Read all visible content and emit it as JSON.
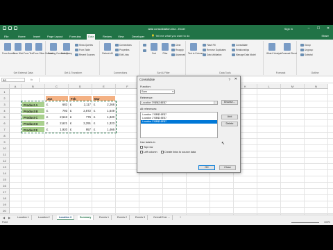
{
  "app": {
    "title": "data consolidation.xlsx - Excel",
    "user": "Sign in",
    "window_controls": [
      "–",
      "☐",
      "✕"
    ]
  },
  "tabs": [
    "File",
    "Home",
    "Insert",
    "Page Layout",
    "Formulas",
    "Data",
    "Review",
    "View",
    "Developer"
  ],
  "active_tab": "Data",
  "tell_me": "Tell me what you want to do",
  "share": "Share",
  "ribbon": {
    "groups": [
      {
        "label": "Get External Data"
      },
      {
        "label": "Get & Transform"
      },
      {
        "label": "Connections"
      },
      {
        "label": "Sort & Filter"
      },
      {
        "label": "Data Tools"
      },
      {
        "label": "Forecast"
      },
      {
        "label": "Outline"
      }
    ],
    "buttons": {
      "from_access": "From Access",
      "from_web": "From Web",
      "from_text": "From Text",
      "from_other": "From Other Sources",
      "existing": "Existing Connections",
      "new_query": "New Query",
      "show_queries": "Show Queries",
      "from_table": "From Table",
      "recent_sources": "Recent Sources",
      "refresh_all": "Refresh All",
      "connections": "Connections",
      "properties": "Properties",
      "edit_links": "Edit Links",
      "sort": "Sort",
      "filter": "Filter",
      "clear": "Clear",
      "reapply": "Reapply",
      "advanced": "Advanced",
      "text_to_columns": "Text to Columns",
      "flash_fill": "Flash Fill",
      "remove_duplicates": "Remove Duplicates",
      "data_validation": "Data Validation",
      "consolidate": "Consolidate",
      "relationships": "Relationships",
      "manage_data_model": "Manage Data Model",
      "what_if": "What-If Analysis",
      "forecast_sheet": "Forecast Sheet",
      "group": "Group",
      "ungroup": "Ungroup",
      "subtotal": "Subtotal"
    }
  },
  "formula_bar": {
    "name_box": "B3",
    "fx": "fx",
    "value": ""
  },
  "grid": {
    "columns": [
      "A",
      "B",
      "C",
      "D",
      "E",
      "F",
      "G",
      "H",
      "I",
      "J",
      "K",
      "L",
      "M",
      "N"
    ],
    "rows": [
      "1",
      "2",
      "3",
      "4",
      "5",
      "6",
      "7",
      "8",
      "9",
      "10",
      "11",
      "12",
      "13",
      "14",
      "15",
      "16",
      "17",
      "18",
      "19",
      "20"
    ],
    "header_row": [
      "Jan",
      "Feb",
      "Mar"
    ],
    "products": [
      {
        "name": "Product A",
        "jan": "683",
        "feb": "2,117",
        "mar": "2,268"
      },
      {
        "name": "Product B",
        "jan": "793",
        "feb": "2,872",
        "mar": "1,649"
      },
      {
        "name": "Product C",
        "jan": "2,543",
        "feb": "776",
        "mar": "1,320"
      },
      {
        "name": "Product D",
        "jan": "2,621",
        "feb": "2,291",
        "mar": "1,323"
      },
      {
        "name": "Product E",
        "jan": "1,920",
        "feb": "957",
        "mar": "1,466"
      }
    ],
    "currency": "£"
  },
  "sheets": {
    "tabs": [
      "Location 1",
      "Location 2",
      "Location 3",
      "Summary",
      "Events 1",
      "Events 2",
      "Events 3",
      "Overall Ever ..."
    ],
    "current": "Location 3",
    "active": "Summary",
    "add": "+"
  },
  "status": {
    "ready": "Point",
    "zoom": "100%"
  },
  "dialog": {
    "title": "Consolidate",
    "help": "?",
    "close": "✕",
    "function_label": "Function:",
    "function_value": "Sum",
    "reference_label": "Reference:",
    "reference_value": "Location 3'!$B$3:$E$7",
    "browse": "Browse...",
    "all_refs_label": "All references:",
    "all_refs": [
      "Location 1'!$B$3:$E$7",
      "Location 2'!$B$3:$E$7",
      "Location 3'!$B$3:$E$7"
    ],
    "selected_ref": 2,
    "add": "Add",
    "delete": "Delete",
    "use_labels_label": "Use labels in",
    "top_row": "Top row",
    "left_column": "Left column",
    "create_links": "Create links to source data",
    "ok": "OK",
    "close_btn": "Close"
  }
}
